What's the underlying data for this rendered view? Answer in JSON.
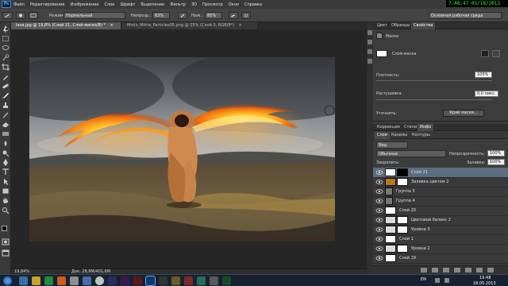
{
  "menu": {
    "items": [
      "Файл",
      "Редактирование",
      "Изображение",
      "Слои",
      "Шрифт",
      "Выделение",
      "Фильтр",
      "3D",
      "Просмотр",
      "Окно",
      "Справка"
    ],
    "clock_display": "7:48:47  05/18/2013"
  },
  "options": {
    "mode_label": "Режим:",
    "mode_value": "Нормальный",
    "opacity_label": "Непрозр.:",
    "opacity_value": "63%",
    "flow_label": "Наж.:",
    "flow_value": "85%",
    "workspace": "Основная рабочая среда"
  },
  "tabs": [
    {
      "title": "lava.jpg @ 19,8% (Слой 21, Слой-маска/8) *",
      "close": "×"
    },
    {
      "title": "Mmio_Mthia_Particles05.png @ 25% (Слой 0, RGB/8*)",
      "close": "×"
    }
  ],
  "status": {
    "zoom": "19,84%",
    "doc": "Док: 28,9M/401,6M"
  },
  "properties": {
    "tabs": [
      "Цвет",
      "Образцы",
      "Свойства"
    ],
    "active_tab": "Свойства",
    "section_title": "Маски",
    "mask_label": "Слой-маска",
    "density_label": "Плотность:",
    "density_value": "100%",
    "feather_label": "Растушевка:",
    "feather_value": "0,0 пикс.",
    "refine_label": "Уточнить:",
    "refine_button": "Край маски..."
  },
  "layers_panel": {
    "tabs": [
      "Коррекция",
      "Стили",
      "Инфо"
    ],
    "sub_tabs": [
      "Слои",
      "Каналы",
      "Контуры"
    ],
    "filter_label": "Вид",
    "blend_mode": "Обычные",
    "opacity_label": "Непрозрачность:",
    "opacity_value": "100%",
    "lock_label": "Закрепить:",
    "fill_label": "Заливка:",
    "fill_value": "100%",
    "layers": [
      {
        "name": "Слой 21",
        "kind": "mask",
        "selected": true
      },
      {
        "name": "Заливка цветом 2",
        "kind": "fill",
        "selected": false
      },
      {
        "name": "Группа 3",
        "kind": "group",
        "selected": false
      },
      {
        "name": "Группа 4",
        "kind": "group",
        "selected": false
      },
      {
        "name": "Слой 20",
        "kind": "layer",
        "selected": false
      },
      {
        "name": "Цветовой баланс 2",
        "kind": "adjust",
        "selected": false
      },
      {
        "name": "Уровни 3",
        "kind": "adjust",
        "selected": false
      },
      {
        "name": "Слой 1",
        "kind": "layer",
        "selected": false
      },
      {
        "name": "Уровни 2",
        "kind": "adjust",
        "selected": false
      },
      {
        "name": "Слой 19",
        "kind": "layer",
        "selected": false
      }
    ]
  },
  "taskbar": {
    "lang": "EN",
    "time": "19:48",
    "date": "18.05.2013"
  }
}
